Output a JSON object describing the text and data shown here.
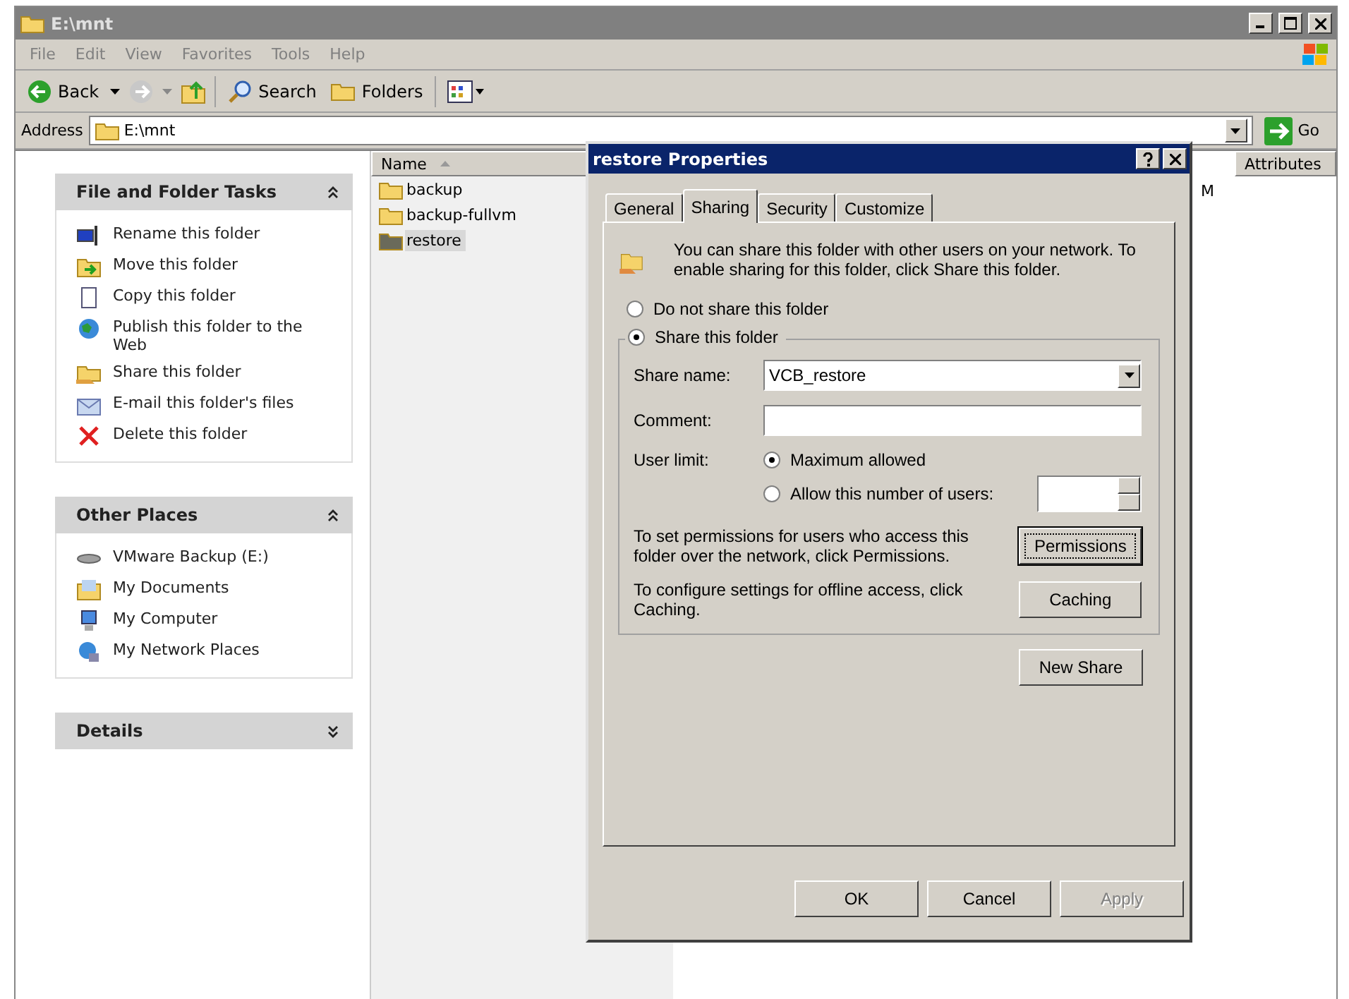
{
  "window": {
    "title": "E:\\mnt"
  },
  "menu": [
    {
      "label": "File"
    },
    {
      "label": "Edit"
    },
    {
      "label": "View"
    },
    {
      "label": "Favorites"
    },
    {
      "label": "Tools"
    },
    {
      "label": "Help"
    }
  ],
  "toolbar": {
    "back": "Back",
    "search": "Search",
    "folders": "Folders"
  },
  "address": {
    "label": "Address",
    "value": "E:\\mnt",
    "go": "Go"
  },
  "panels": [
    {
      "title": "File and Folder Tasks",
      "expanded": true,
      "items": [
        "Rename this folder",
        "Move this folder",
        "Copy this folder",
        "Publish this folder to the Web",
        "Share this folder",
        "E-mail this folder's files",
        "Delete this folder"
      ]
    },
    {
      "title": "Other Places",
      "expanded": true,
      "items": [
        "VMware Backup (E:)",
        "My Documents",
        "My Computer",
        "My Network Places"
      ]
    },
    {
      "title": "Details",
      "expanded": false
    }
  ],
  "file_list": {
    "name_column": "Name",
    "last_column": "Attributes",
    "rows": [
      {
        "name": "backup",
        "selected": false,
        "column_2": "M"
      },
      {
        "name": "backup-fullvm",
        "selected": false
      },
      {
        "name": "restore",
        "selected": true
      }
    ]
  },
  "dialog": {
    "title": "restore Properties",
    "tabs": [
      {
        "label": "General",
        "selected": false
      },
      {
        "label": "Sharing",
        "selected": true
      },
      {
        "label": "Security",
        "selected": false
      },
      {
        "label": "Customize",
        "selected": false
      }
    ],
    "intro": "You can share this folder with other users on your network.  To enable sharing for this folder, click Share this folder.",
    "share_options": [
      {
        "label": "Do not share this folder",
        "selected": false
      },
      {
        "label": "Share this folder",
        "selected": true
      }
    ],
    "share_name_label": "Share name:",
    "share_name": "VCB_restore",
    "comment_label": "Comment:",
    "user_limit_label": "User limit:",
    "limit_options": [
      {
        "label": "Maximum allowed",
        "selected": true
      },
      {
        "label": "Allow this number of users:",
        "selected": false
      }
    ],
    "permissions_text": "To set permissions for users who access this folder over the network, click Permissions.",
    "permissions_button": "Permissions",
    "caching_text": "To configure settings for offline access, click Caching.",
    "caching_button": "Caching",
    "new_share_button": "New Share",
    "buttons": [
      {
        "label": "OK",
        "disabled": false
      },
      {
        "label": "Cancel",
        "disabled": false
      },
      {
        "label": "Apply",
        "disabled": true
      }
    ]
  }
}
